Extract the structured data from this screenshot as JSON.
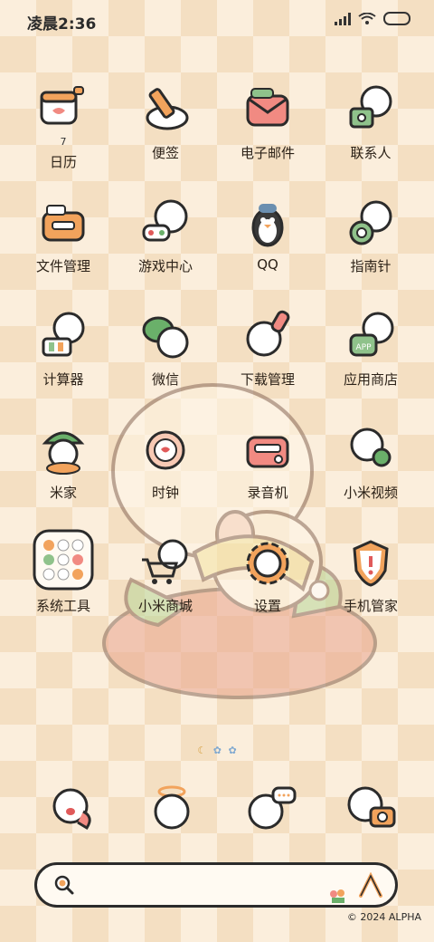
{
  "status_bar": {
    "time": "凌晨2:36"
  },
  "apps": [
    [
      {
        "label": "日历",
        "icon": "calendar-icon",
        "badge": "7"
      },
      {
        "label": "便签",
        "icon": "notes-icon"
      },
      {
        "label": "电子邮件",
        "icon": "mail-icon"
      },
      {
        "label": "联系人",
        "icon": "contacts-icon"
      }
    ],
    [
      {
        "label": "文件管理",
        "icon": "files-icon"
      },
      {
        "label": "游戏中心",
        "icon": "game-icon"
      },
      {
        "label": "QQ",
        "icon": "qq-penguin-icon"
      },
      {
        "label": "指南针",
        "icon": "compass-icon"
      }
    ],
    [
      {
        "label": "计算器",
        "icon": "calculator-icon"
      },
      {
        "label": "微信",
        "icon": "wechat-icon"
      },
      {
        "label": "下载管理",
        "icon": "download-icon"
      },
      {
        "label": "应用商店",
        "icon": "app-store-icon"
      }
    ],
    [
      {
        "label": "米家",
        "icon": "mijia-icon"
      },
      {
        "label": "时钟",
        "icon": "clock-icon"
      },
      {
        "label": "录音机",
        "icon": "recorder-icon"
      },
      {
        "label": "小米视频",
        "icon": "video-icon"
      }
    ],
    [
      {
        "label": "系统工具",
        "icon": "folder-icon"
      },
      {
        "label": "小米商城",
        "icon": "shop-cart-icon"
      },
      {
        "label": "设置",
        "icon": "settings-gear-icon"
      },
      {
        "label": "手机管家",
        "icon": "security-shield-icon"
      }
    ]
  ],
  "dock": [
    {
      "icon": "phone-sheep-icon"
    },
    {
      "icon": "browser-sheep-icon"
    },
    {
      "icon": "messages-sheep-icon"
    },
    {
      "icon": "camera-sheep-icon"
    }
  ],
  "pager": {
    "dots": [
      "☾",
      "✿",
      "✿"
    ]
  },
  "search": {
    "placeholder": ""
  },
  "copyright": "© 2024 ALPHA",
  "colors": {
    "accent": "#f0a050",
    "checker_light": "#fbeedc",
    "checker_dark": "#f4dfc2",
    "outline": "#2b2b2b"
  }
}
